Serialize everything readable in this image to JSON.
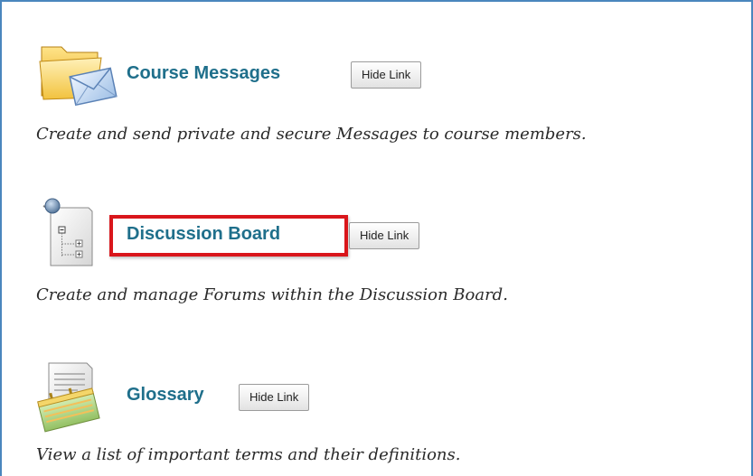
{
  "tools": [
    {
      "id": "course-messages",
      "icon": "folder-envelope-icon",
      "label": "Course Messages",
      "hide_label": "Hide Link",
      "description": "Create and send private and secure Messages to course members."
    },
    {
      "id": "discussion-board",
      "icon": "discussion-board-icon",
      "label": "Discussion Board",
      "hide_label": "Hide Link",
      "description": "Create and manage Forums within the Discussion Board.",
      "highlighted": true
    },
    {
      "id": "glossary",
      "icon": "glossary-notepad-icon",
      "label": "Glossary",
      "hide_label": "Hide Link",
      "description": "View a list of important terms and their definitions."
    }
  ],
  "colors": {
    "link": "#1f6f8b",
    "highlight": "#d9161b",
    "panel_border": "#4a86bd"
  }
}
